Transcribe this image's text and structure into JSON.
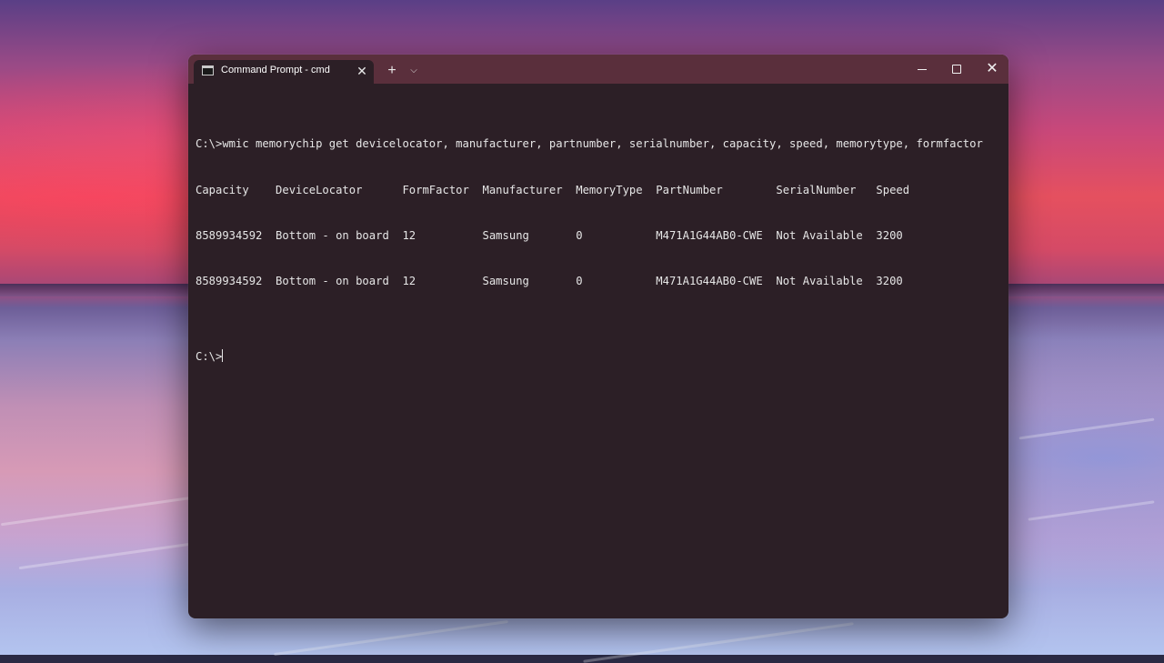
{
  "window": {
    "tab_title": "Command Prompt - cmd",
    "tab_close_label": "✕",
    "new_tab_label": "+",
    "tab_menu_label": "⌵",
    "close_label": "✕"
  },
  "console": {
    "command_line": "C:\\>wmic memorychip get devicelocator, manufacturer, partnumber, serialnumber, capacity, speed, memorytype, formfactor",
    "columns": [
      "Capacity",
      "DeviceLocator",
      "FormFactor",
      "Manufacturer",
      "MemoryType",
      "PartNumber",
      "SerialNumber",
      "Speed"
    ],
    "header_line": "Capacity    DeviceLocator      FormFactor  Manufacturer  MemoryType  PartNumber        SerialNumber   Speed",
    "rows": [
      {
        "values": [
          "8589934592",
          "Bottom - on board",
          "12",
          "Samsung",
          "0",
          "M471A1G44AB0-CWE",
          "Not Available",
          "3200"
        ],
        "line": "8589934592  Bottom - on board  12          Samsung       0           M471A1G44AB0-CWE  Not Available  3200"
      },
      {
        "values": [
          "8589934592",
          "Bottom - on board",
          "12",
          "Samsung",
          "0",
          "M471A1G44AB0-CWE",
          "Not Available",
          "3200"
        ],
        "line": "8589934592  Bottom - on board  12          Samsung       0           M471A1G44AB0-CWE  Not Available  3200"
      }
    ],
    "prompt": "C:\\>"
  }
}
